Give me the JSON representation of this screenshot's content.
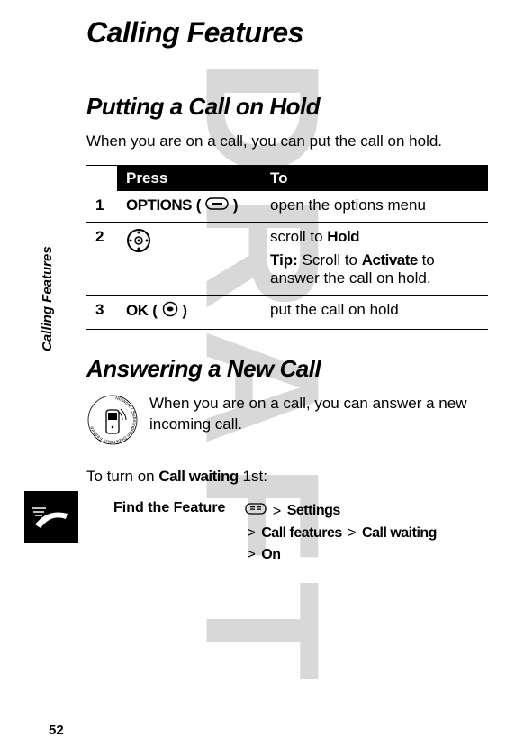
{
  "watermark": "DRAFT",
  "sidebar_label": "Calling Features",
  "page_number": "52",
  "title": "Calling Features",
  "section1": {
    "heading": "Putting a Call on Hold",
    "intro": "When you are on a call, you can put the call on hold.",
    "table": {
      "head_press": "Press",
      "head_to": "To",
      "rows": [
        {
          "num": "1",
          "press_prefix": "OPTIONS",
          "press_paren_open": " ( ",
          "press_paren_close": " )",
          "to": "open the options menu"
        },
        {
          "num": "2",
          "to_line1_pre": "scroll to ",
          "to_line1_bold": "Hold",
          "tip_label": "Tip:",
          "tip_text_pre": " Scroll to ",
          "tip_text_bold": "Activate",
          "tip_text_post": " to answer the call on hold."
        },
        {
          "num": "3",
          "press_prefix": "OK",
          "press_paren_open": " ( ",
          "press_paren_close": " )",
          "to": "put the call on hold"
        }
      ]
    }
  },
  "section2": {
    "heading": "Answering a New Call",
    "intro": "When you are on a call, you can answer a new incoming call.",
    "turn_on_pre": "To turn on ",
    "turn_on_bold": "Call waiting",
    "turn_on_post": " 1st:",
    "find_feature": "Find the Feature",
    "nav": {
      "s1": "Settings",
      "s2": "Call features",
      "s3": "Call waiting",
      "s4": "On",
      "gt": ">"
    }
  }
}
